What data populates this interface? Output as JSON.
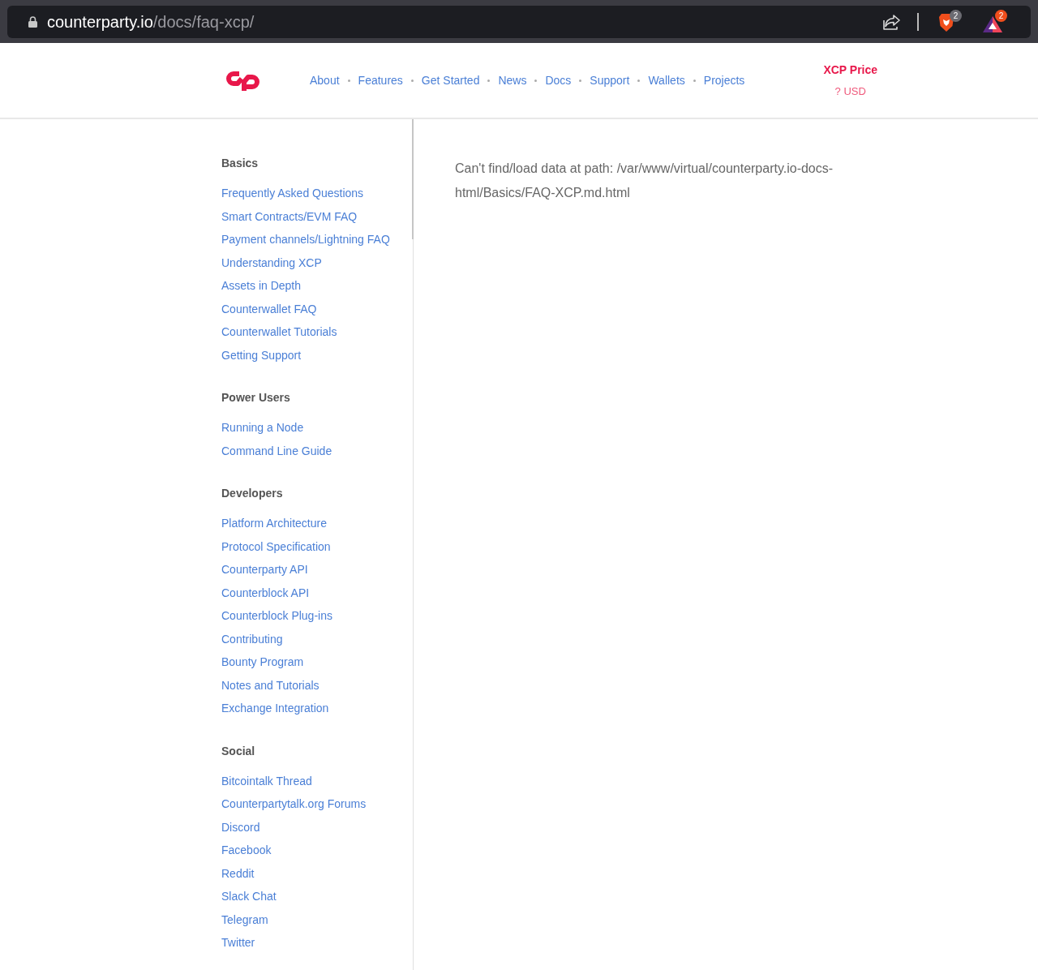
{
  "browser": {
    "url_host": "counterparty.io",
    "url_path": "/docs/faq-xcp/",
    "shield_badge": "2",
    "rewards_badge": "2"
  },
  "nav": {
    "links": [
      "About",
      "Features",
      "Get Started",
      "News",
      "Docs",
      "Support",
      "Wallets",
      "Projects"
    ],
    "price_title": "XCP Price",
    "price_value": "? USD"
  },
  "sidebar": {
    "sections": [
      {
        "heading": "Basics",
        "links": [
          "Frequently Asked Questions",
          "Smart Contracts/EVM FAQ",
          "Payment channels/Lightning FAQ",
          "Understanding XCP",
          "Assets in Depth",
          "Counterwallet FAQ",
          "Counterwallet Tutorials",
          "Getting Support"
        ]
      },
      {
        "heading": "Power Users",
        "links": [
          "Running a Node",
          "Command Line Guide"
        ]
      },
      {
        "heading": "Developers",
        "links": [
          "Platform Architecture",
          "Protocol Specification",
          "Counterparty API",
          "Counterblock API",
          "Counterblock Plug-ins",
          "Contributing",
          "Bounty Program",
          "Notes and Tutorials",
          "Exchange Integration"
        ]
      },
      {
        "heading": "Social",
        "links": [
          "Bitcointalk Thread",
          "Counterpartytalk.org Forums",
          "Discord",
          "Facebook",
          "Reddit",
          "Slack Chat",
          "Telegram",
          "Twitter"
        ]
      }
    ]
  },
  "content": {
    "message": "Can't find/load data at path: /var/www/virtual/counterparty.io-docs-html/Basics/FAQ-XCP.md.html"
  }
}
